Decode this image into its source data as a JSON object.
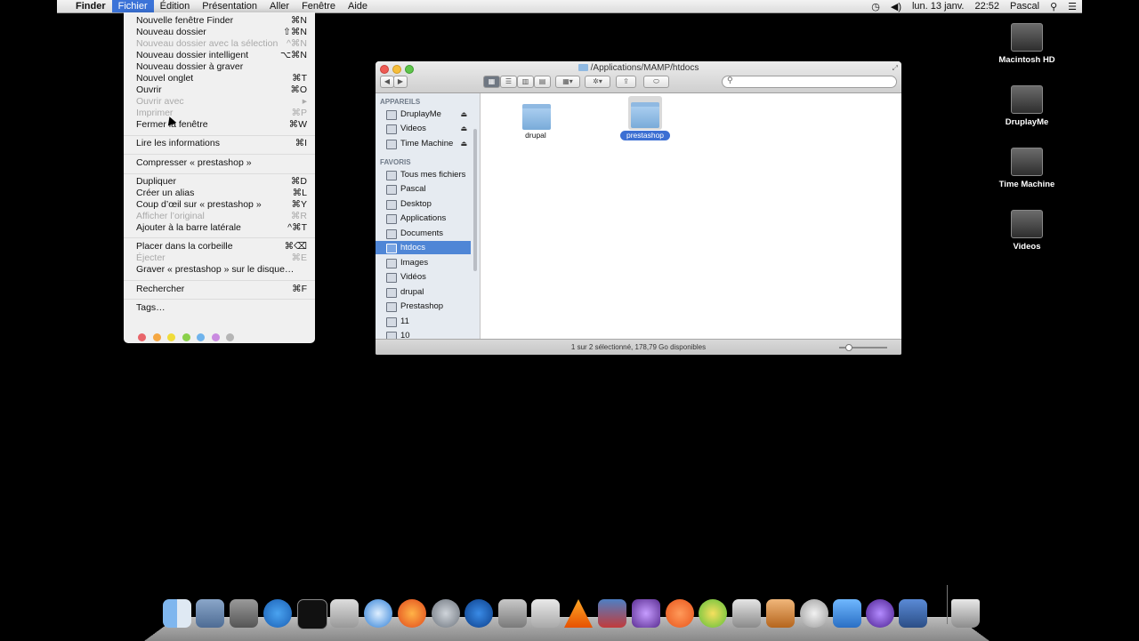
{
  "menubar": {
    "apple": "",
    "items": [
      "Finder",
      "Fichier",
      "Édition",
      "Présentation",
      "Aller",
      "Fenêtre",
      "Aide"
    ],
    "date": "lun. 13 janv.",
    "time": "22:52",
    "user": "Pascal"
  },
  "file_menu": {
    "items": [
      {
        "label": "Nouvelle fenêtre Finder",
        "shortcut": "⌘N"
      },
      {
        "label": "Nouveau dossier",
        "shortcut": "⇧⌘N"
      },
      {
        "label": "Nouveau dossier avec la sélection",
        "shortcut": "^⌘N"
      },
      {
        "label": "Nouveau dossier intelligent",
        "shortcut": "⌥⌘N"
      },
      {
        "label": "Nouveau dossier à graver",
        "shortcut": ""
      },
      {
        "label": "Nouvel onglet",
        "shortcut": "⌘T"
      },
      {
        "label": "Ouvrir",
        "shortcut": "⌘O"
      },
      {
        "label": "Ouvrir avec",
        "shortcut": "▸"
      },
      {
        "label": "Imprimer",
        "shortcut": "⌘P"
      },
      {
        "label": "Fermer la fenêtre",
        "shortcut": "⌘W"
      },
      {
        "label": "Lire les informations",
        "shortcut": "⌘I"
      },
      {
        "label": "Compresser « prestashop »",
        "shortcut": ""
      },
      {
        "label": "Dupliquer",
        "shortcut": "⌘D"
      },
      {
        "label": "Créer un alias",
        "shortcut": "⌘L"
      },
      {
        "label": "Coup d’œil sur « prestashop »",
        "shortcut": "⌘Y"
      },
      {
        "label": "Afficher l’original",
        "shortcut": "⌘R"
      },
      {
        "label": "Ajouter à la barre latérale",
        "shortcut": "^⌘T"
      },
      {
        "label": "Placer dans la corbeille",
        "shortcut": "⌘⌫"
      },
      {
        "label": "Éjecter",
        "shortcut": "⌘E"
      },
      {
        "label": "Graver « prestashop » sur le disque…",
        "shortcut": ""
      },
      {
        "label": "Rechercher",
        "shortcut": "⌘F"
      },
      {
        "label": "Tags…",
        "shortcut": ""
      }
    ],
    "tag_colors": [
      "#e8656a",
      "#f5a742",
      "#f0dc3a",
      "#8ad04a",
      "#6fb3ec",
      "#c98ae0",
      "#b5b5b5"
    ]
  },
  "finder": {
    "title": "/Applications/MAMP/htdocs",
    "sidebar": {
      "devices_header": "APPAREILS",
      "devices": [
        "DruplayMe",
        "Videos",
        "Time Machine"
      ],
      "favorites_header": "FAVORIS",
      "favorites": [
        "Tous mes fichiers",
        "Pascal",
        "Desktop",
        "Applications",
        "Documents",
        "htdocs",
        "Images",
        "Vidéos",
        "drupal",
        "Prestashop",
        "11",
        "10"
      ]
    },
    "files": [
      "drupal",
      "prestashop"
    ],
    "status": "1 sur 2 sélectionné, 178,79 Go disponibles"
  },
  "desktop_icons": [
    "Macintosh HD",
    "DruplayMe",
    "Time Machine",
    "Videos"
  ]
}
